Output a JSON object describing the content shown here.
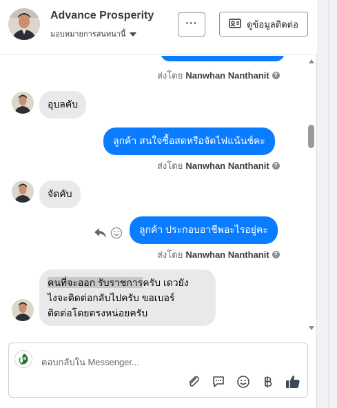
{
  "header": {
    "title": "Advance Prosperity",
    "subtitle": "มอบหมายการสนทนานี้",
    "more_label": "···",
    "contact_label": "ดูข้อมูลติดต่อ"
  },
  "messages": {
    "m1": {
      "sent_by_prefix": "ส่งโดย",
      "sent_by_name": "Nanwhan Nanthanit"
    },
    "m2": {
      "text": "อุบลคับ"
    },
    "m3": {
      "text": "ลูกค้า สนใจซื้อสดหรือจัดไฟแน้นช์คะ",
      "sent_by_prefix": "ส่งโดย",
      "sent_by_name": "Nanwhan Nanthanit"
    },
    "m4": {
      "text": "จัดคับ"
    },
    "m5": {
      "text": "ลูกค้า ประกอบอาชีพอะไรอยู่คะ",
      "sent_by_prefix": "ส่งโดย",
      "sent_by_name": "Nanwhan Nanthanit"
    },
    "m6": {
      "line1_highlight": "คนที่จะออก",
      "line1_highlight2": " รับราชการ",
      "line1_rest": "ครับ เดวยัง",
      "line2": "ไงจะติดต่อกลับไปครับ ขอเบอร์",
      "line3": "ติดต่อโดยตรงหน่อยครับ"
    }
  },
  "composer": {
    "placeholder": "ตอบกลับใน Messenger..."
  },
  "colors": {
    "outgoing_bubble": "#0a7cff",
    "incoming_bubble": "#e9e9eb",
    "like_icon": "#3b4a5a"
  }
}
